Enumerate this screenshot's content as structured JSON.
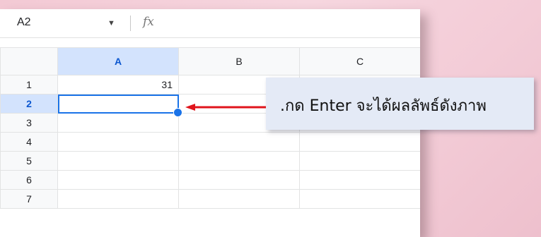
{
  "formula_bar": {
    "name_box": "A2",
    "fx_label": "fx",
    "formula": ""
  },
  "columns": [
    "A",
    "B",
    "C"
  ],
  "rows": [
    {
      "num": "1",
      "a": "31",
      "b": "",
      "c": ""
    },
    {
      "num": "2",
      "a": "",
      "b": "",
      "c": ""
    },
    {
      "num": "3",
      "a": "",
      "b": "",
      "c": ""
    },
    {
      "num": "4",
      "a": "",
      "b": "",
      "c": ""
    },
    {
      "num": "5",
      "a": "",
      "b": "",
      "c": ""
    },
    {
      "num": "6",
      "a": "",
      "b": "",
      "c": ""
    },
    {
      "num": "7",
      "a": "",
      "b": "",
      "c": ""
    }
  ],
  "selected_cell": "A2",
  "callout": {
    "text": ".กด Enter จะได้ผลลัพธ์ดังภาพ"
  },
  "colors": {
    "selection": "#1a73e8",
    "header_active": "#d3e3fd",
    "arrow": "#e0141c",
    "callout_bg": "#e4eaf6"
  }
}
